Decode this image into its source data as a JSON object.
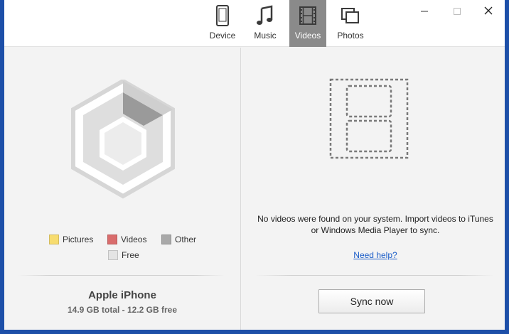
{
  "tabs": [
    {
      "label": "Device",
      "icon": "phone-icon",
      "active": false
    },
    {
      "label": "Music",
      "icon": "music-note-icon",
      "active": false
    },
    {
      "label": "Videos",
      "icon": "film-icon",
      "active": true
    },
    {
      "label": "Photos",
      "icon": "photos-icon",
      "active": false
    }
  ],
  "window_controls": {
    "minimize": "minimize-icon",
    "maximize": "maximize-icon",
    "close": "close-icon"
  },
  "storage": {
    "legend": [
      {
        "label": "Pictures",
        "color": "#f7dc6f"
      },
      {
        "label": "Videos",
        "color": "#d96c6c"
      },
      {
        "label": "Other",
        "color": "#a9a9a9"
      },
      {
        "label": "Free",
        "color": "#e4e4e4"
      }
    ],
    "chart_colors": {
      "used": "#9a9a9a",
      "free": "#dedede"
    }
  },
  "device": {
    "name": "Apple iPhone",
    "storage_text": "14.9 GB total - 12.2 GB free"
  },
  "videos": {
    "empty_message": "No videos were found on your system. Import videos to iTunes or Windows Media Player to sync.",
    "help_link": "Need help?",
    "sync_button": "Sync now"
  },
  "colors": {
    "active_tab": "#8a8a8a",
    "link": "#1a5cc8",
    "window_border": "#1d4fa8"
  }
}
